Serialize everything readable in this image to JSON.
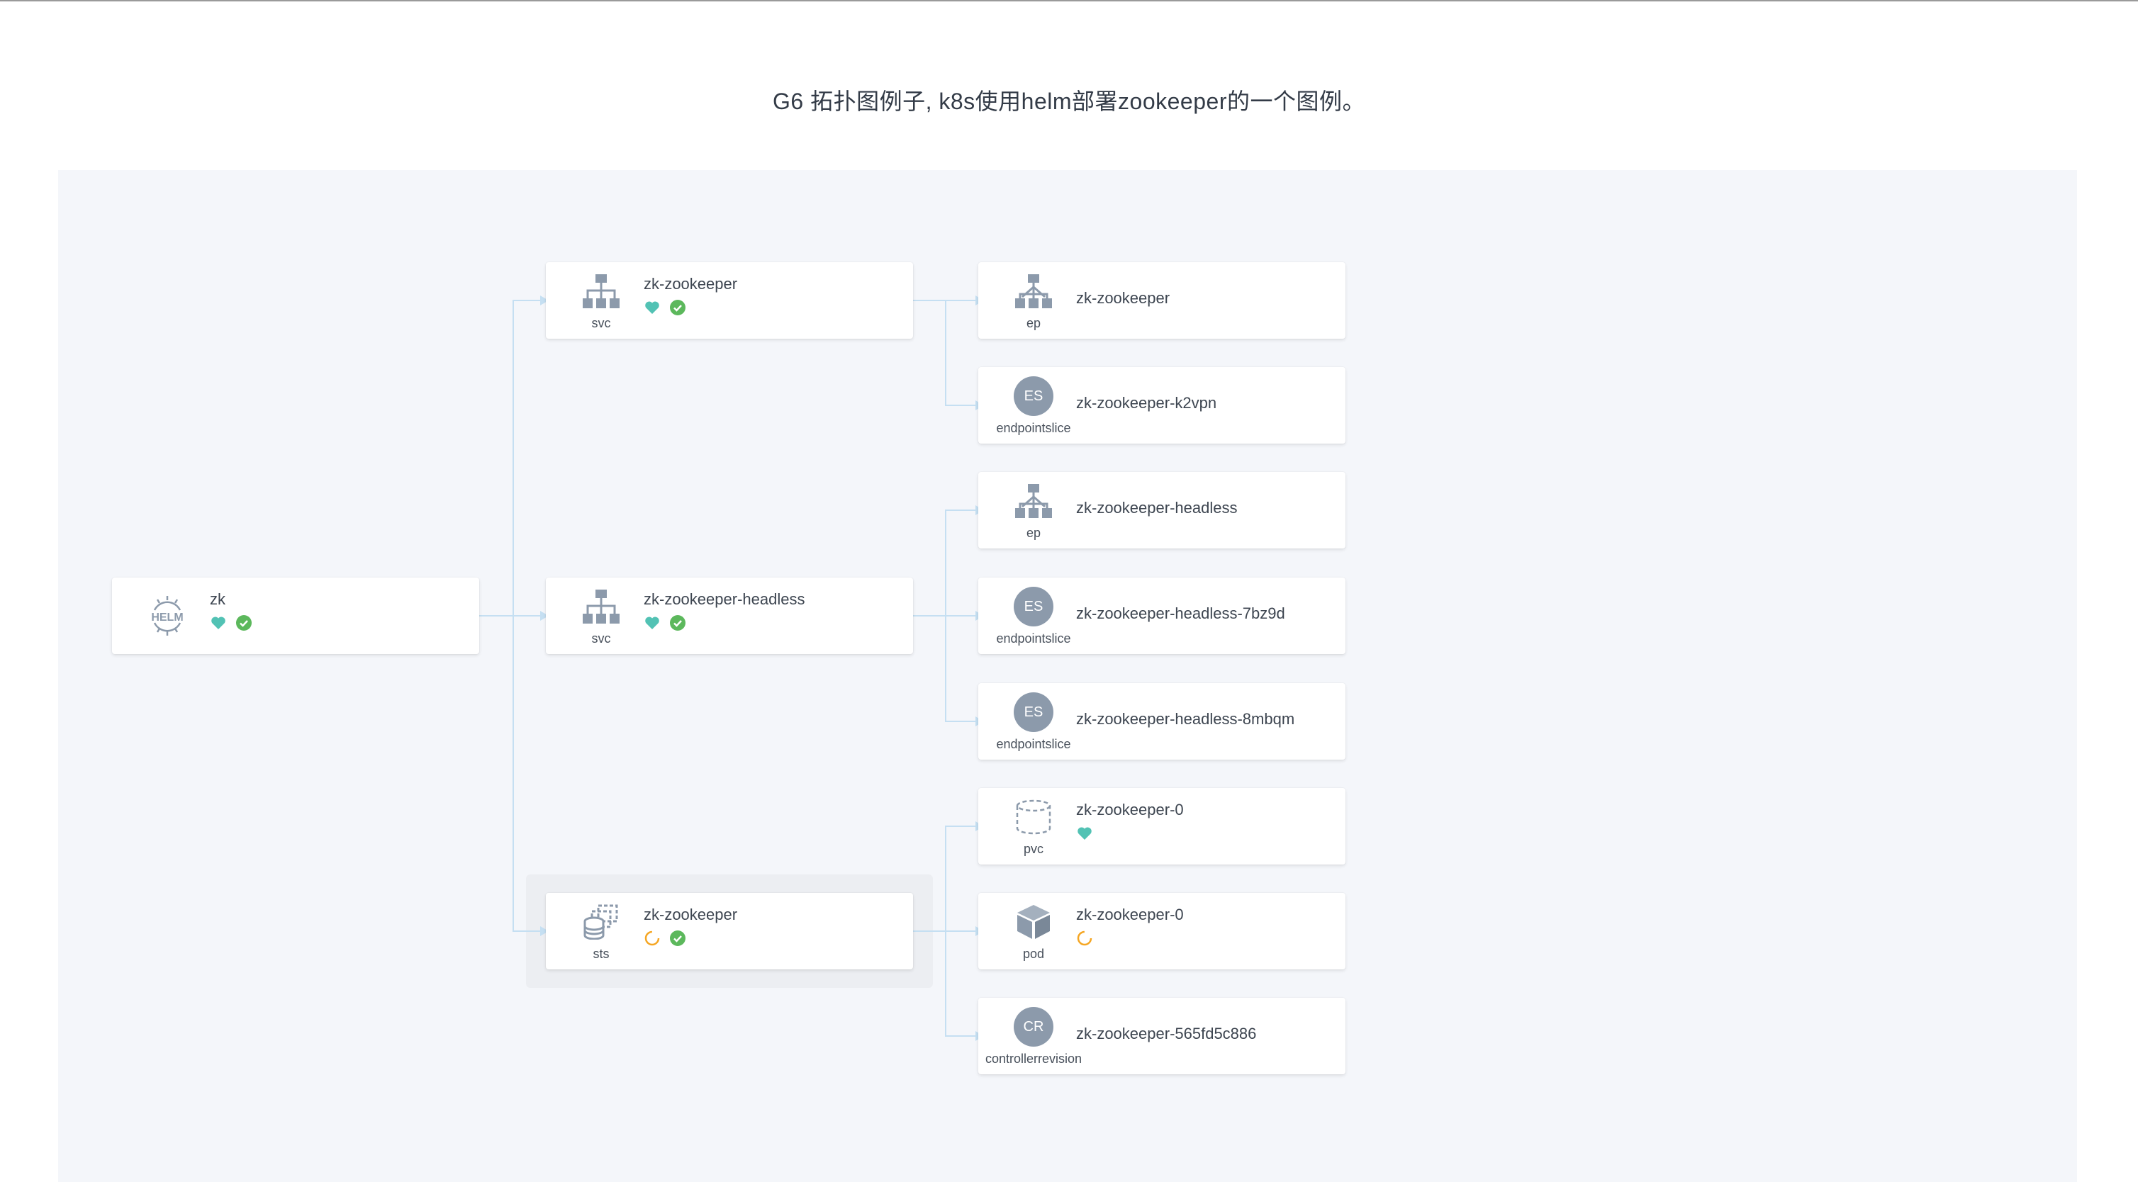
{
  "title": "G6 拓扑图例子, k8s使用helm部署zookeeper的一个图例。",
  "colors": {
    "canvas_bg": "#f4f6fa",
    "edge": "#c5dff2",
    "icon_gray": "#8c9aab",
    "healthy_teal": "#52c2b4",
    "check_green": "#5cb85c",
    "pending_orange": "#f5a623"
  },
  "nodes": {
    "helm": {
      "kind": "",
      "name": "zk",
      "icon": "helm-icon",
      "status": [
        "heart",
        "check"
      ]
    },
    "svc1": {
      "kind": "svc",
      "name": "zk-zookeeper",
      "icon": "service-icon",
      "status": [
        "heart",
        "check"
      ]
    },
    "svc2": {
      "kind": "svc",
      "name": "zk-zookeeper-headless",
      "icon": "service-icon",
      "status": [
        "heart",
        "check"
      ]
    },
    "sts": {
      "kind": "sts",
      "name": "zk-zookeeper",
      "icon": "statefulset-icon",
      "status": [
        "pending",
        "check"
      ]
    },
    "ep1": {
      "kind": "ep",
      "name": "zk-zookeeper",
      "icon": "endpoint-icon"
    },
    "es1": {
      "kind": "endpointslice",
      "name": "zk-zookeeper-k2vpn",
      "icon_text": "ES"
    },
    "ep2": {
      "kind": "ep",
      "name": "zk-zookeeper-headless",
      "icon": "endpoint-icon"
    },
    "es2": {
      "kind": "endpointslice",
      "name": "zk-zookeeper-headless-7bz9d",
      "icon_text": "ES"
    },
    "es3": {
      "kind": "endpointslice",
      "name": "zk-zookeeper-headless-8mbqm",
      "icon_text": "ES"
    },
    "pvc": {
      "kind": "pvc",
      "name": "zk-zookeeper-0",
      "icon": "pvc-icon",
      "status": [
        "heart"
      ]
    },
    "pod": {
      "kind": "pod",
      "name": "zk-zookeeper-0",
      "icon": "pod-icon",
      "status": [
        "pending"
      ]
    },
    "cr": {
      "kind": "controllerrevision",
      "name": "zk-zookeeper-565fd5c886",
      "icon_text": "CR"
    }
  }
}
